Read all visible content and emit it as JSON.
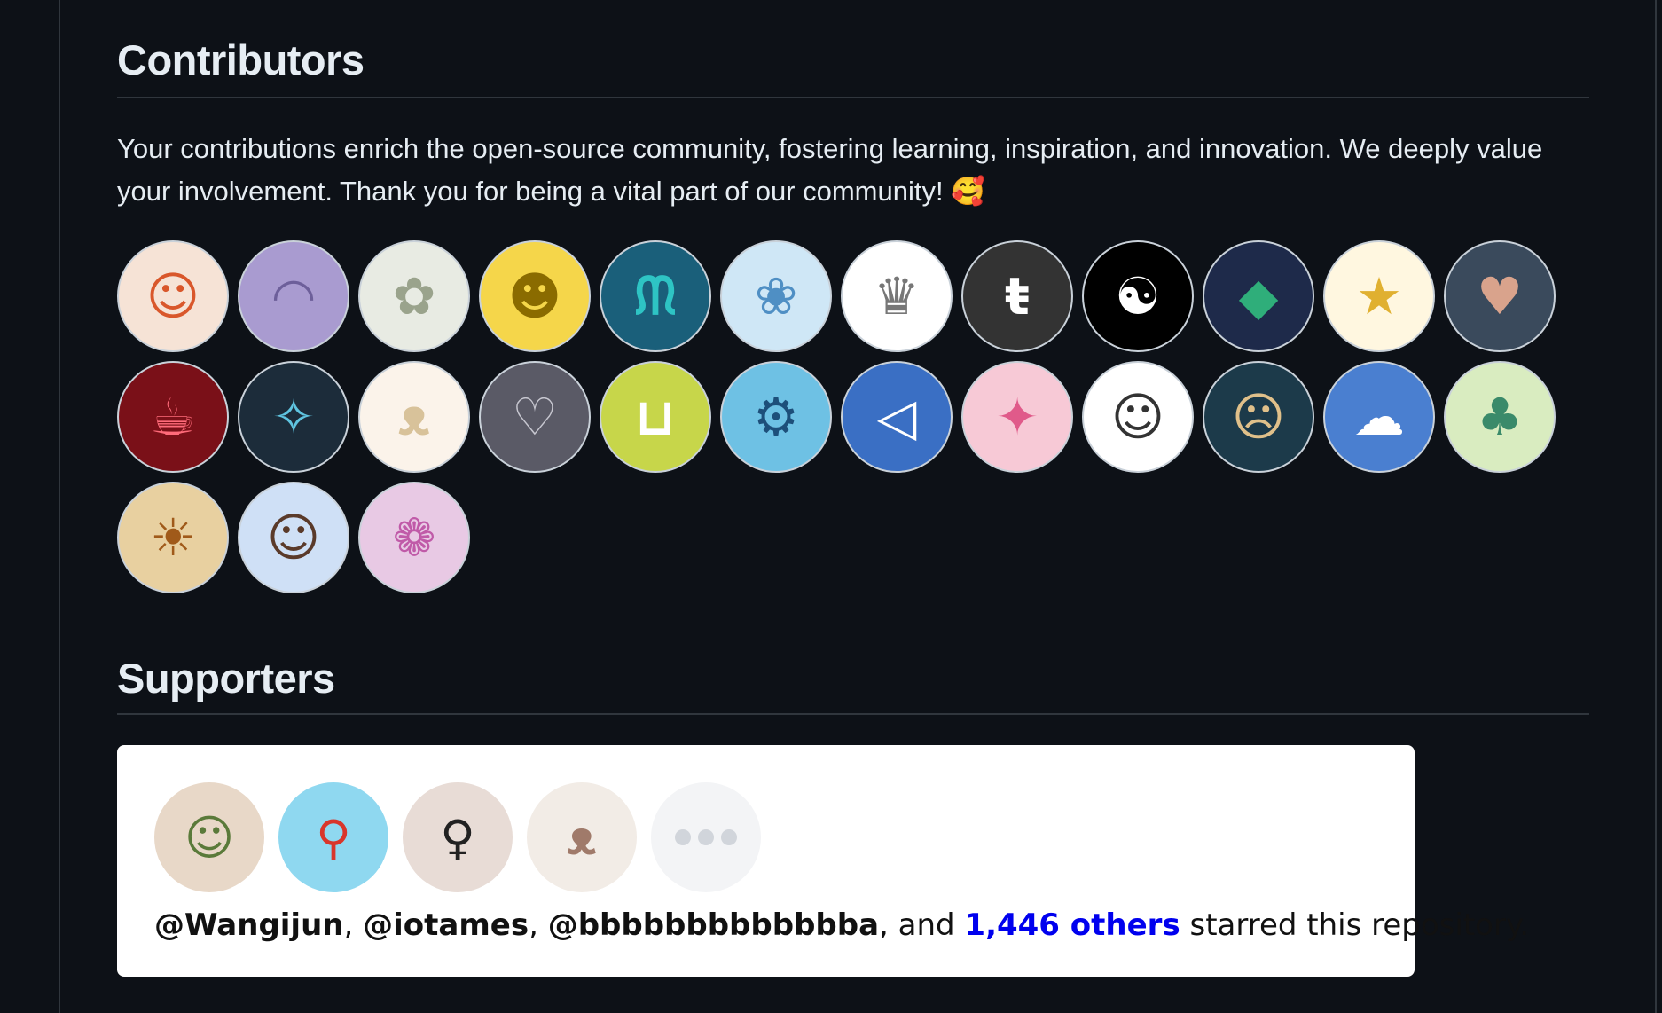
{
  "contributors": {
    "heading": "Contributors",
    "intro": "Your contributions enrich the open-source community, fostering learning, inspiration, and innovation. We deeply value your involvement. Thank you for being a vital part of our community! 🥰",
    "avatars": [
      {
        "glyph": "☺",
        "bg": "#f6e3d6",
        "fg": "#d9572b"
      },
      {
        "glyph": "◠",
        "bg": "#a99bd0",
        "fg": "#6d5f9a"
      },
      {
        "glyph": "✿",
        "bg": "#e8ebe3",
        "fg": "#9aa38c"
      },
      {
        "glyph": "☻",
        "bg": "#f5d64a",
        "fg": "#8a6b00"
      },
      {
        "glyph": "ᙏ",
        "bg": "#1a5f7a",
        "fg": "#2ec4c4"
      },
      {
        "glyph": "❀",
        "bg": "#cfe7f6",
        "fg": "#4f8fc4"
      },
      {
        "glyph": "♛",
        "bg": "#ffffff",
        "fg": "#777777"
      },
      {
        "glyph": "ŧ",
        "bg": "#333333",
        "fg": "#ffffff"
      },
      {
        "glyph": "☯",
        "bg": "#000000",
        "fg": "#ffffff"
      },
      {
        "glyph": "◆",
        "bg": "#1e2a4a",
        "fg": "#2fae7a"
      },
      {
        "glyph": "★",
        "bg": "#fff7e0",
        "fg": "#e0b030"
      },
      {
        "glyph": "♥",
        "bg": "#3a4a5c",
        "fg": "#d9a38c"
      },
      {
        "glyph": "☕",
        "bg": "#7a1018",
        "fg": "#ff6b7a"
      },
      {
        "glyph": "✧",
        "bg": "#1c2c3a",
        "fg": "#5fc4e0"
      },
      {
        "glyph": "ᴥ",
        "bg": "#fbf3ea",
        "fg": "#d8c29a"
      },
      {
        "glyph": "♡",
        "bg": "#5a5a66",
        "fg": "#c7c7d0"
      },
      {
        "glyph": "⊔",
        "bg": "#c7d64a",
        "fg": "#ffffff"
      },
      {
        "glyph": "⚙",
        "bg": "#6ec1e4",
        "fg": "#1d4f7a"
      },
      {
        "glyph": "◁",
        "bg": "#3a6fc4",
        "fg": "#ffffff"
      },
      {
        "glyph": "✦",
        "bg": "#f7c9d6",
        "fg": "#e05a8a"
      },
      {
        "glyph": "☺",
        "bg": "#ffffff",
        "fg": "#333333"
      },
      {
        "glyph": "☹",
        "bg": "#1c3a4a",
        "fg": "#e0c08a"
      },
      {
        "glyph": "☁",
        "bg": "#4a7fd0",
        "fg": "#ffffff"
      },
      {
        "glyph": "♣",
        "bg": "#d9ecc0",
        "fg": "#3a8a6a"
      },
      {
        "glyph": "☀",
        "bg": "#e8d0a0",
        "fg": "#a05a1a"
      },
      {
        "glyph": "☺",
        "bg": "#cfe0f6",
        "fg": "#5a3a2a"
      },
      {
        "glyph": "❁",
        "bg": "#e8c9e4",
        "fg": "#c05aa8"
      }
    ]
  },
  "supporters": {
    "heading": "Supporters",
    "avatars": [
      {
        "glyph": "☺",
        "bg": "#e8d8c8",
        "fg": "#5a7a3a"
      },
      {
        "glyph": "⚲",
        "bg": "#8fd8f0",
        "fg": "#d9362b"
      },
      {
        "glyph": "♀",
        "bg": "#e8dcd6",
        "fg": "#222222"
      },
      {
        "glyph": "ᴥ",
        "bg": "#f2ece6",
        "fg": "#a07a6a"
      }
    ],
    "user1": "@Wangijun",
    "sep1": ", ",
    "user2": "@iotames",
    "sep2": ", ",
    "user3": "@bbbbbbbbbbbbba",
    "sep3": ", and ",
    "others": "1,446 others",
    "suffix": " starred this repository."
  }
}
